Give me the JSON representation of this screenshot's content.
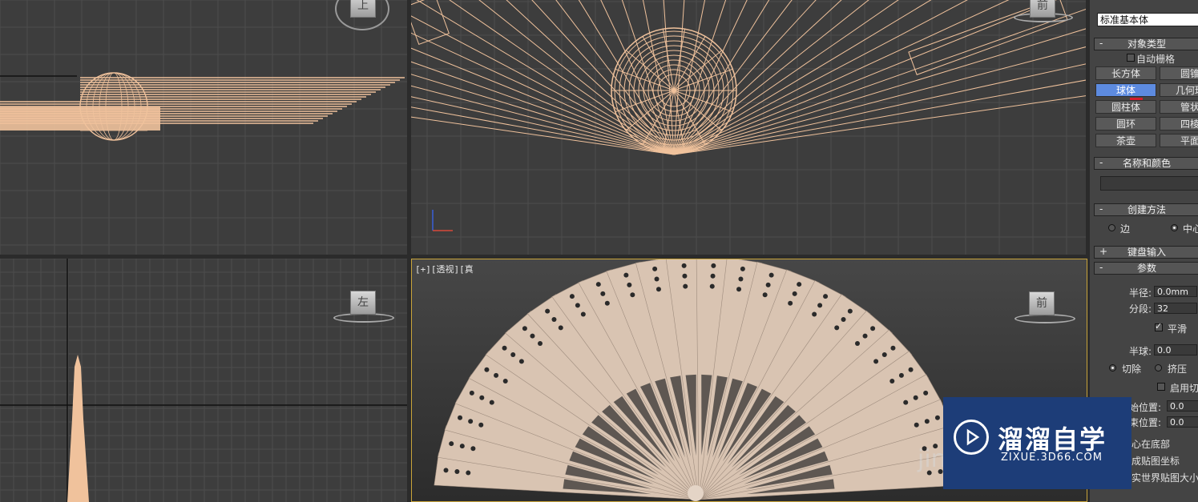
{
  "viewports": {
    "top": {
      "cube_label": "上"
    },
    "front": {
      "cube_label": "前"
    },
    "left": {
      "cube_label": "左"
    },
    "perspective": {
      "label": "[+][透视][真",
      "cube_label": "前"
    }
  },
  "panel": {
    "dropdown_value": "标准基本体",
    "object_type": {
      "title": "对象类型",
      "autogrid_label": "自动栅格",
      "buttons": [
        "长方体",
        "圆锥",
        "球体",
        "几何球",
        "圆柱体",
        "管状",
        "圆环",
        "四棱",
        "茶壶",
        "平面"
      ],
      "active_button": "球体"
    },
    "name_color": {
      "title": "名称和颜色",
      "name_value": ""
    },
    "creation_method": {
      "title": "创建方法",
      "option_edge": "边",
      "option_center": "中心",
      "selected": "中心"
    },
    "keyboard_entry": {
      "title": "键盘输入"
    },
    "parameters": {
      "title": "参数",
      "radius_label": "半径:",
      "radius_value": "0.0mm",
      "segments_label": "分段:",
      "segments_value": "32",
      "smooth_label": "平滑",
      "hemisphere_label": "半球:",
      "hemisphere_value": "0.0",
      "chop_label": "切除",
      "squash_label": "挤压",
      "enable_slice_label": "启用切",
      "slice_from_label": "始位置:",
      "slice_from_value": "0.0",
      "slice_to_label": "束位置:",
      "slice_to_value": "0.0",
      "base_to_pivot_label": "心在底部",
      "gen_map_label": "成贴图坐标",
      "real_world_label": "实世界贴图大小"
    }
  },
  "watermark": {
    "brand": "溜溜自学",
    "url": "ZIXUE.3D66.COM",
    "ghost_text": "jin"
  },
  "colors": {
    "viewport_bg": "#3d3d3d",
    "wire": "#f0c29c",
    "fan": "#d9c4b2",
    "active_button": "#5d8be0",
    "watermark_bg": "#1d3d78"
  }
}
